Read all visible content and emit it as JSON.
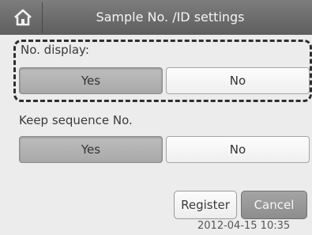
{
  "header": {
    "title": "Sample No. /ID settings",
    "home_icon": "home-icon"
  },
  "no_display": {
    "label": "No. display:",
    "yes": "Yes",
    "no": "No",
    "selected": "Yes"
  },
  "keep_sequence": {
    "label": "Keep sequence No.",
    "yes": "Yes",
    "no": "No",
    "selected": "Yes"
  },
  "actions": {
    "register": "Register",
    "cancel": "Cancel"
  },
  "status": {
    "datetime": "2012-04-15 10:35"
  }
}
